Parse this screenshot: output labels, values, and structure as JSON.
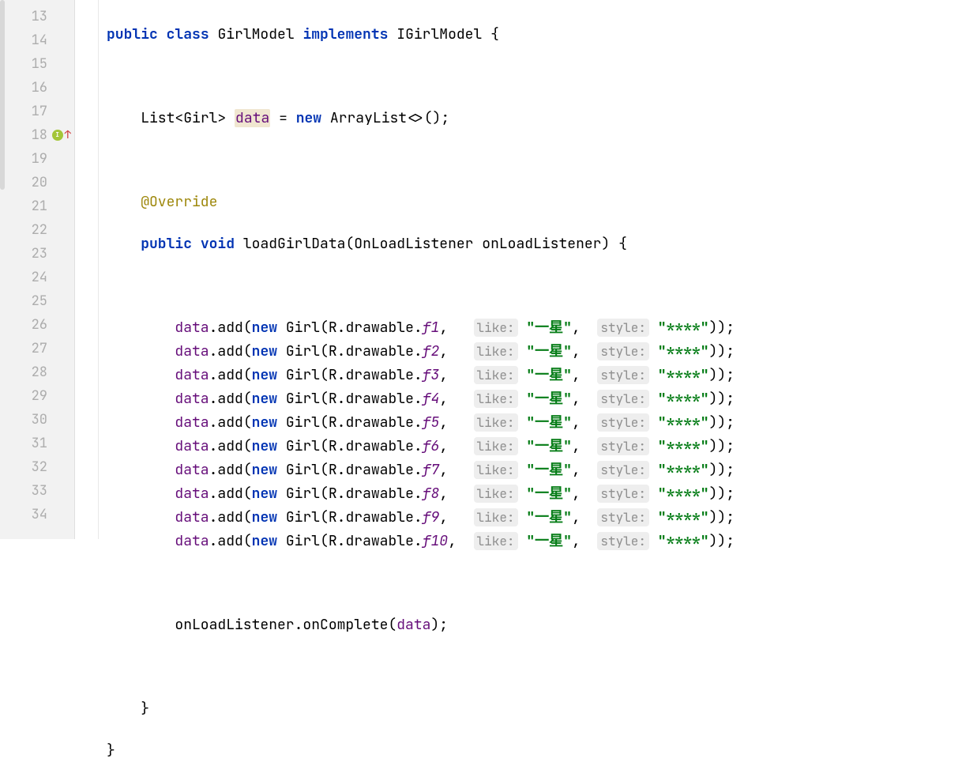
{
  "lineNumbers": [
    "13",
    "14",
    "15",
    "16",
    "17",
    "18",
    "19",
    "20",
    "21",
    "22",
    "23",
    "24",
    "25",
    "26",
    "27",
    "28",
    "29",
    "30",
    "31",
    "32",
    "33",
    "34"
  ],
  "code": {
    "kw_public": "public",
    "kw_class": "class",
    "kw_implements": "implements",
    "kw_void": "void",
    "kw_new": "new",
    "className": "GirlModel",
    "interfaceName": "IGirlModel",
    "listType": "List",
    "girlType": "Girl",
    "dataField": "data",
    "arrayListType": "ArrayList",
    "override": "@Override",
    "methodName": "loadGirlData",
    "paramType": "OnLoadListener",
    "paramName": "onLoadListener",
    "addMethod": "add",
    "rDrawable": "R.drawable.",
    "drawableIds": [
      "f1",
      "f2",
      "f3",
      "f4",
      "f5",
      "f6",
      "f7",
      "f8",
      "f9",
      "f10"
    ],
    "hintLike": "like:",
    "likeStr": "\"一星\"",
    "hintStyle": "style:",
    "styleStr": "\"****\"",
    "onComplete": "onComplete",
    "openBrace": "{",
    "closeBrace": "}",
    "openParen": "(",
    "closeParen": ")",
    "semi": ";",
    "comma": ",",
    "eq": "=",
    "lt": "<",
    "gt": ">",
    "dot": ".",
    "diamond": "<>()"
  }
}
